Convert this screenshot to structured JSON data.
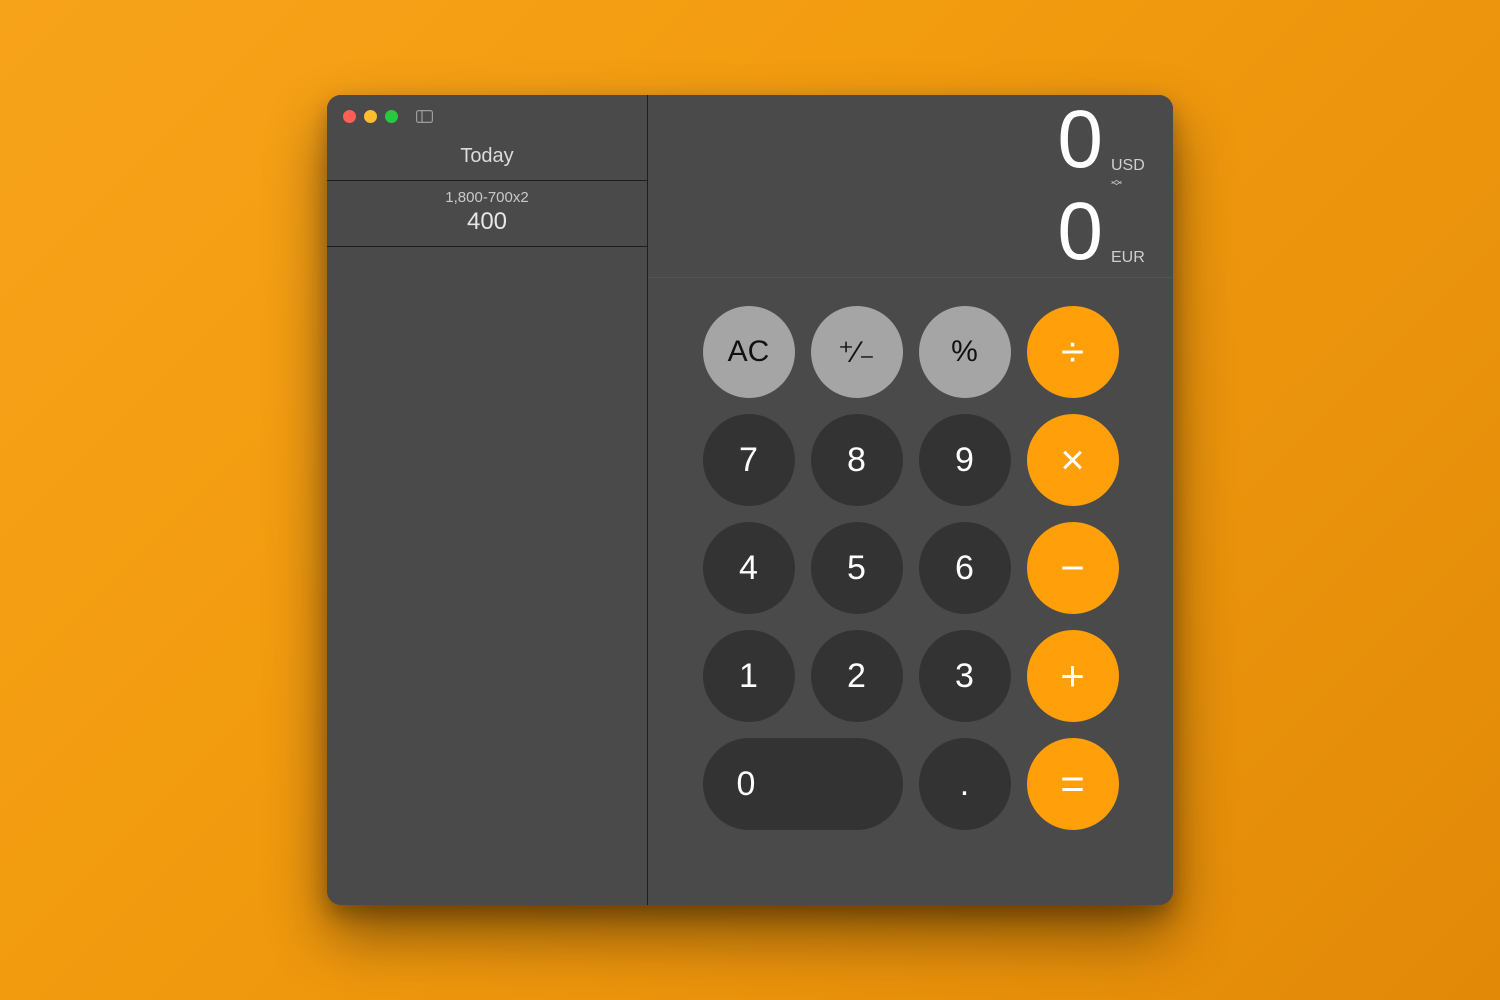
{
  "colors": {
    "accent": "#ff9f0a",
    "bg": "#4a4a4a"
  },
  "sidebar": {
    "header": "Today",
    "history": [
      {
        "expression": "1,800-700x2",
        "result": "400"
      }
    ]
  },
  "display": {
    "primary_value": "0",
    "primary_currency": "USD",
    "secondary_value": "0",
    "secondary_currency": "EUR"
  },
  "keys": {
    "ac": "AC",
    "sign": "⁺∕₋",
    "percent": "%",
    "divide": "÷",
    "multiply": "×",
    "minus": "−",
    "plus": "+",
    "equals": "=",
    "decimal": ".",
    "n0": "0",
    "n1": "1",
    "n2": "2",
    "n3": "3",
    "n4": "4",
    "n5": "5",
    "n6": "6",
    "n7": "7",
    "n8": "8",
    "n9": "9"
  }
}
